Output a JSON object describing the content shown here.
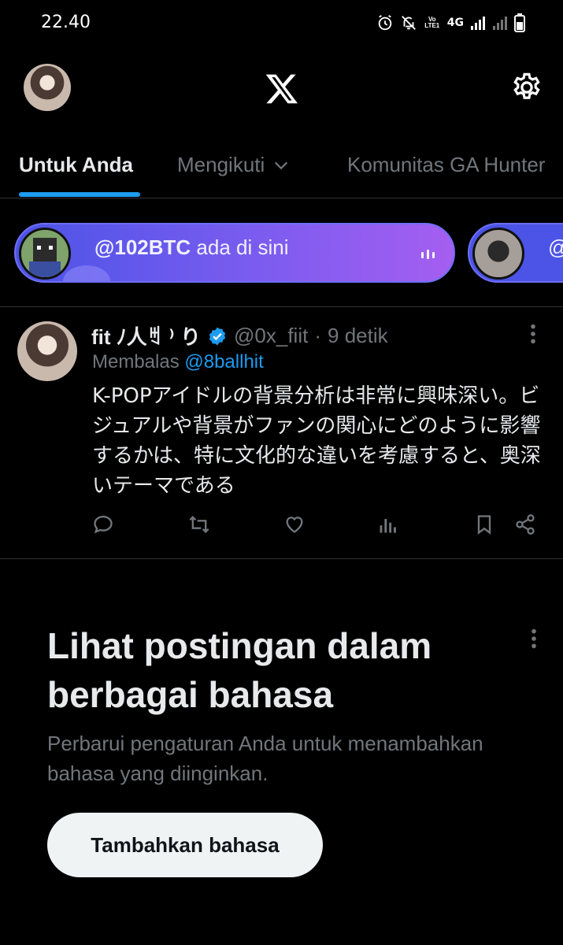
{
  "status_bar": {
    "time": "22.40",
    "network": "4G",
    "volte": "Vo LTE1",
    "icons": [
      "alarm-icon",
      "notifications-off-icon",
      "volte-icon",
      "signal-icon",
      "signal-weak-icon",
      "battery-icon"
    ]
  },
  "header": {
    "logo": "X",
    "icons": [
      "profile-avatar",
      "x-logo-icon",
      "gear-icon"
    ]
  },
  "tabs": [
    {
      "label": "Untuk Anda",
      "active": true
    },
    {
      "label": "Mengikuti",
      "active": false
    },
    {
      "label": "Komunitas GA Hunter",
      "active": false
    }
  ],
  "spaces": [
    {
      "host": "@102BTC",
      "suffix": " ada di sini"
    },
    {
      "host": "@"
    }
  ],
  "tweet": {
    "display_name": "fit ﾉ人ꒄ ⁾ り",
    "handle": "@0x_fiit",
    "separator": "·",
    "time": "9 detik",
    "reply_prefix": "Membalas ",
    "reply_to": "@8ballhit",
    "text": "K-POPアイドルの背景分析は非常に興味深い。ビジュアルや背景がファンの関心にどのように影響するかは、特に文化的な違いを考慮すると、奥深いテーマである",
    "actions": [
      "reply-icon",
      "retweet-icon",
      "like-icon",
      "views-icon",
      "bookmark-icon",
      "share-icon"
    ]
  },
  "language_prompt": {
    "title": "Lihat postingan dalam berbagai bahasa",
    "subtitle": "Perbarui pengaturan Anda untuk menambahkan bahasa yang diinginkan.",
    "button": "Tambahkan bahasa"
  },
  "colors": {
    "background": "#000000",
    "accent": "#1d9bf0",
    "text_primary": "#e7e9ea",
    "text_secondary": "#71767b",
    "divider": "#2f3336",
    "space_gradient_start": "#4b54e6",
    "space_gradient_end": "#a55ef0"
  }
}
